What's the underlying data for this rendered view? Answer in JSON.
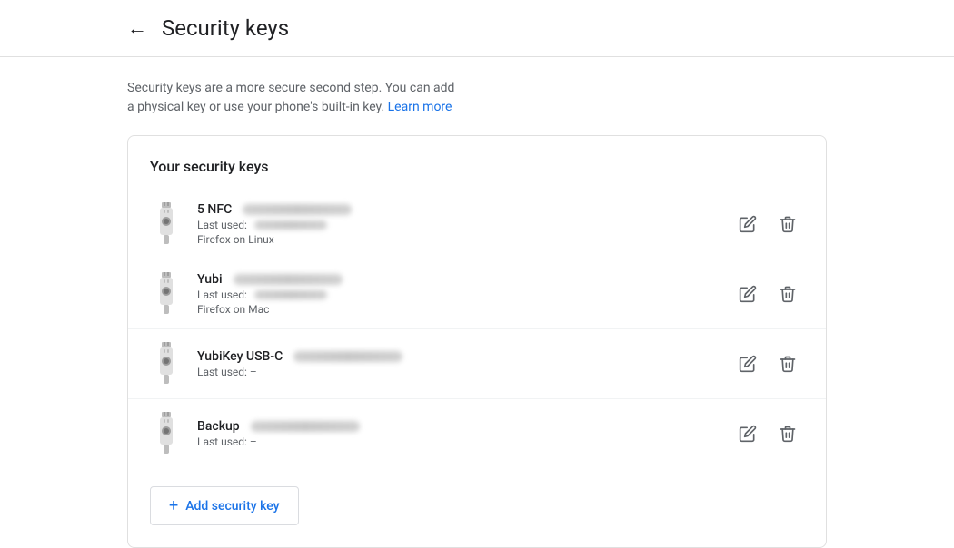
{
  "header": {
    "back_label": "←",
    "title": "Security keys"
  },
  "description": {
    "text": "Security keys are a more secure second step. You can add a physical key or use your phone's built-in key.",
    "learn_more_label": "Learn more",
    "learn_more_url": "#"
  },
  "card": {
    "title": "Your security keys",
    "keys": [
      {
        "id": "key-1",
        "name": "5 NFC",
        "has_blur_name": true,
        "last_used_label": "Last used:",
        "has_blur_date": true,
        "browser": "Firefox on Linux"
      },
      {
        "id": "key-2",
        "name": "Yubi",
        "has_blur_name": true,
        "last_used_label": "Last used:",
        "has_blur_date": true,
        "browser": "Firefox on Mac"
      },
      {
        "id": "key-3",
        "name": "YubiKey USB-C",
        "has_blur_name": true,
        "last_used_label": "Last used: –",
        "has_blur_date": false,
        "browser": ""
      },
      {
        "id": "key-4",
        "name": "Backup",
        "has_blur_name": true,
        "last_used_label": "Last used: –",
        "has_blur_date": false,
        "browser": ""
      }
    ],
    "add_button_label": "Add security key"
  },
  "icons": {
    "edit": "edit-icon",
    "delete": "delete-icon",
    "back": "back-arrow-icon",
    "add": "plus-icon"
  }
}
